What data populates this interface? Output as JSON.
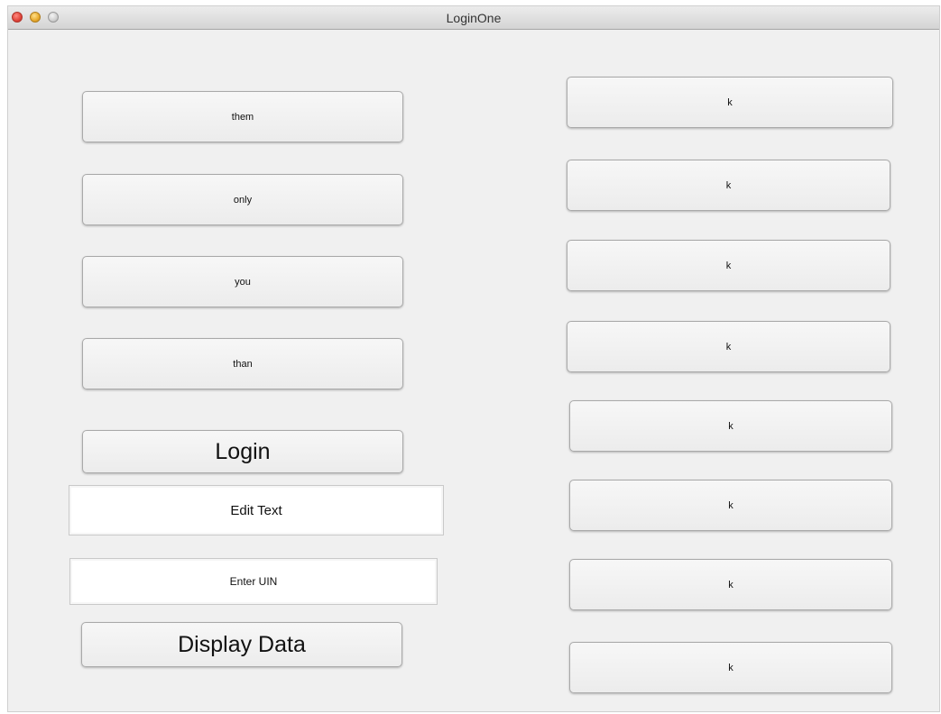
{
  "window": {
    "title": "LoginOne"
  },
  "left_buttons": [
    {
      "label": "them"
    },
    {
      "label": "only"
    },
    {
      "label": "you"
    },
    {
      "label": "than"
    }
  ],
  "login_button": {
    "label": "Login"
  },
  "edit_text_field": {
    "value": "Edit Text"
  },
  "uin_field": {
    "value": "Enter UIN"
  },
  "display_button": {
    "label": "Display Data"
  },
  "right_buttons": [
    {
      "label": "k"
    },
    {
      "label": "k"
    },
    {
      "label": "k"
    },
    {
      "label": "k"
    },
    {
      "label": "k"
    },
    {
      "label": "k"
    },
    {
      "label": "k"
    },
    {
      "label": "k"
    }
  ]
}
